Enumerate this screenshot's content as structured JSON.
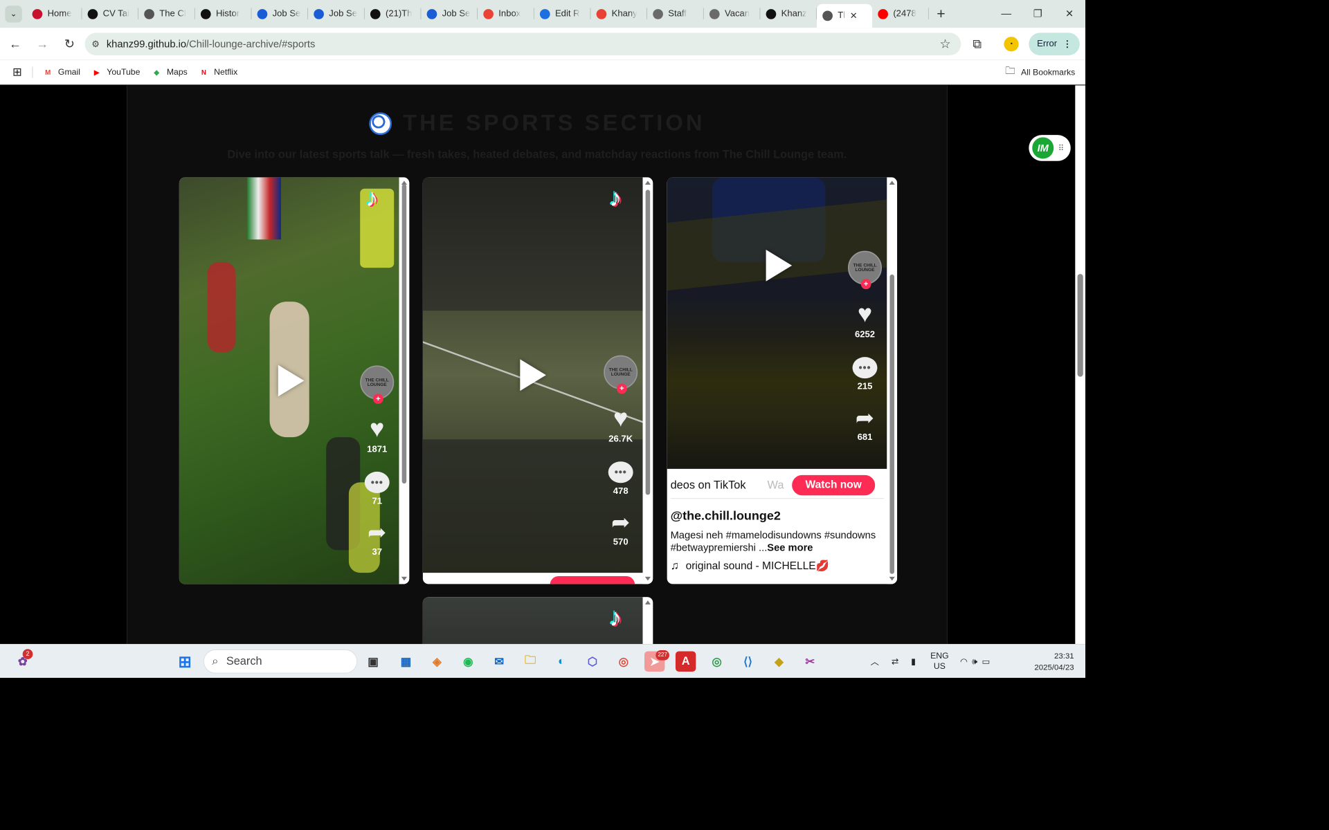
{
  "browser": {
    "tabs": [
      {
        "title": "Home",
        "icon": "red-swoosh-icon",
        "color": "#c8102e"
      },
      {
        "title": "CV Tai",
        "icon": "chatgpt-icon",
        "color": "#111111"
      },
      {
        "title": "The Cl",
        "icon": "globe-icon",
        "color": "#555555"
      },
      {
        "title": "Histor",
        "icon": "github-icon",
        "color": "#111111"
      },
      {
        "title": "Job Se",
        "icon": "info-icon",
        "color": "#1a5bd6"
      },
      {
        "title": "Job Se",
        "icon": "info-icon",
        "color": "#1a5bd6"
      },
      {
        "title": "(21)Th",
        "icon": "tiktok-icon",
        "color": "#111111"
      },
      {
        "title": "Job Se",
        "icon": "info-icon",
        "color": "#1a5bd6"
      },
      {
        "title": "Inbox",
        "icon": "gmail-icon",
        "color": "#ea4335"
      },
      {
        "title": "Edit R",
        "icon": "bookmark-blue-icon",
        "color": "#1e6fe0"
      },
      {
        "title": "Khany",
        "icon": "apps-grid-icon",
        "color": "#e94235"
      },
      {
        "title": "Staff",
        "icon": "shield-icon",
        "color": "#6a6a6a"
      },
      {
        "title": "Vacan",
        "icon": "shield-icon",
        "color": "#6a6a6a"
      },
      {
        "title": "Khanz",
        "icon": "github-icon",
        "color": "#111111"
      },
      {
        "title": "Tl",
        "icon": "globe-icon",
        "color": "#555555",
        "active": true
      },
      {
        "title": "(2478",
        "icon": "youtube-icon",
        "color": "#ff0000"
      }
    ],
    "url_host": "khanz99.github.io",
    "url_path": "/Chill-lounge-archive/#sports",
    "error_label": "Error",
    "bookmarks": [
      {
        "label": "Gmail",
        "icon": "gmail-icon",
        "color": "#ea4335"
      },
      {
        "label": "YouTube",
        "icon": "youtube-icon",
        "color": "#ff0000"
      },
      {
        "label": "Maps",
        "icon": "maps-icon",
        "color": "#34a853"
      },
      {
        "label": "Netflix",
        "icon": "netflix-icon",
        "color": "#e50914"
      }
    ],
    "all_bookmarks": "All Bookmarks"
  },
  "page": {
    "title": "THE SPORTS SECTION",
    "subtitle": "Dive into our latest sports talk — fresh takes, heated debates, and matchday reactions from The Chill Lounge team.",
    "profile_text": "THE CHILL LOUNGE",
    "videos": [
      {
        "likes": "1871",
        "comments": "71",
        "shares": "37"
      },
      {
        "likes": "26.7K",
        "comments": "478",
        "shares": "570"
      },
      {
        "likes": "6252",
        "comments": "215",
        "shares": "681",
        "promo_text": "deos on TikTok",
        "promo_faded": "Wa",
        "watch_now": "Watch now",
        "handle": "@the.chill.lounge2",
        "caption": "Magesi neh #mamelodisundowns #sundowns #betwaypremiershi ...",
        "see_more": "See more",
        "sound": "original sound - MICHELLE💋"
      }
    ]
  },
  "taskbar": {
    "search_placeholder": "Search",
    "lang_line1": "ENG",
    "lang_line2": "US",
    "time": "23:31",
    "date": "2025/04/23",
    "notif_badge": "2",
    "telegram_badge": "227"
  },
  "colors": {
    "tiktok_red": "#fe2c55",
    "accent_teal": "#c4e7e0"
  }
}
